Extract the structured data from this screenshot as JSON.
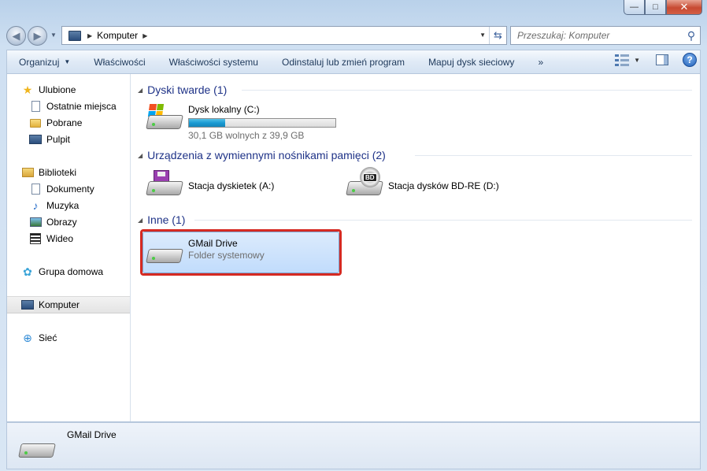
{
  "window": {
    "caption": {
      "minimize": "—",
      "maximize": "□",
      "close": "✕"
    }
  },
  "nav": {
    "back_icon": "back-arrow-icon",
    "forward_icon": "forward-arrow-icon",
    "address": {
      "crumbs": [
        "Komputer"
      ]
    },
    "search": {
      "placeholder": "Przeszukaj: Komputer"
    }
  },
  "toolbar": {
    "items": [
      "Organizuj",
      "Właściwości",
      "Właściwości systemu",
      "Odinstaluj lub zmień program",
      "Mapuj dysk sieciowy"
    ],
    "more": "»",
    "help": "?"
  },
  "sidebar": {
    "favorites": {
      "label": "Ulubione",
      "items": [
        "Ostatnie miejsca",
        "Pobrane",
        "Pulpit"
      ]
    },
    "libraries": {
      "label": "Biblioteki",
      "items": [
        "Dokumenty",
        "Muzyka",
        "Obrazy",
        "Wideo"
      ]
    },
    "homegroup": "Grupa domowa",
    "computer": "Komputer",
    "network": "Sieć"
  },
  "content": {
    "groups": [
      {
        "title": "Dyski twarde (1)",
        "items": [
          {
            "name": "Dysk lokalny (C:)",
            "free_text": "30,1 GB wolnych z 39,9 GB",
            "used_fraction": 0.246
          }
        ]
      },
      {
        "title": "Urządzenia z wymiennymi nośnikami pamięci (2)",
        "items": [
          {
            "name": "Stacja dyskietek (A:)"
          },
          {
            "name": "Stacja dysków BD-RE (D:)",
            "badge": "BD"
          }
        ]
      },
      {
        "title": "Inne (1)",
        "items": [
          {
            "name": "GMail Drive",
            "subtitle": "Folder systemowy"
          }
        ]
      }
    ]
  },
  "details": {
    "name": "GMail Drive"
  },
  "colors": {
    "highlight_border": "#d52a22",
    "selection": "#c1dcfc",
    "group_heading": "#1e3287"
  }
}
